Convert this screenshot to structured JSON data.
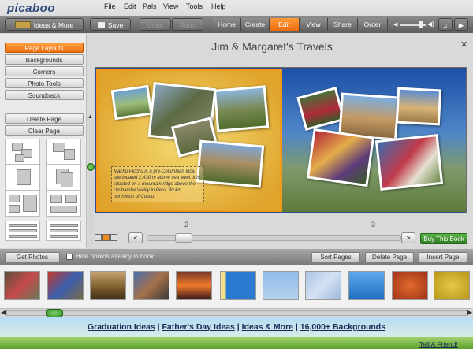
{
  "app": {
    "logo": "picaboo",
    "menu": [
      "File",
      "Edit",
      "Pals",
      "View",
      "Tools",
      "Help"
    ]
  },
  "toolbar": {
    "ideas_label": "Ideas & More",
    "save_label": "Save",
    "undo_label": "Undo",
    "redo_label": "Redo",
    "nav": [
      "Home",
      "Create",
      "Edit",
      "View",
      "Share",
      "Order"
    ],
    "active_nav": "Edit"
  },
  "left_panel": {
    "tabs": [
      "Page Layouts",
      "Backgrounds",
      "Corners",
      "Photo Tools",
      "Soundtrack"
    ],
    "active_tab": "Page Layouts",
    "delete_page": "Delete Page",
    "clear_page": "Clear Page"
  },
  "book": {
    "title": "Jim & Margaret's Travels",
    "caption": "Machu Picchu is a pre-Columbian Inca site located 2,430 m above sea level. It is situated on a mountain ridge above the Urubamba Valley in Peru, 80 km northwest of Cusco.",
    "left_page_number": "2",
    "right_page_number": "3",
    "buy_label": "Buy This Book"
  },
  "photo_tray": {
    "get_photos": "Get Photos",
    "hide_label": "Hide photos already in book",
    "sort_pages": "Sort Pages",
    "delete_page": "Delete Page",
    "insert_page": "Insert Page"
  },
  "footer": {
    "links": [
      "Graduation Ideas",
      "Father's Day Ideas",
      "Ideas & More",
      "16,000+ Backgrounds"
    ],
    "tell_friend": "Tell A Friend!"
  },
  "colors": {
    "accent": "#f07010",
    "buy": "#2f7d22",
    "link": "#1b2a56"
  }
}
